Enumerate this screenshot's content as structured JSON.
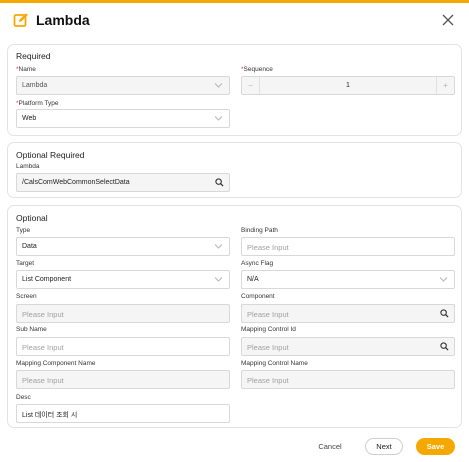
{
  "dialog": {
    "title": "Lambda",
    "accent_color": "#f5a800"
  },
  "required": {
    "title": "Required",
    "name": {
      "label": "Name",
      "required_mark": "*",
      "value": "Lambda"
    },
    "sequence": {
      "label": "Sequence",
      "required_mark": "*",
      "value": "1",
      "minus": "−",
      "plus": "+"
    },
    "platform_type": {
      "label": "Platform Type",
      "required_mark": "*",
      "value": "Web"
    }
  },
  "optional_required": {
    "title": "Optional Required",
    "lambda": {
      "label": "Lambda",
      "value": "/CalsComWebCommonSelectData"
    }
  },
  "optional": {
    "title": "Optional",
    "type": {
      "label": "Type",
      "value": "Data"
    },
    "binding_path": {
      "label": "Binding Path",
      "placeholder": "Please Input"
    },
    "target": {
      "label": "Target",
      "value": "List Component"
    },
    "async_flag": {
      "label": "Async Flag",
      "value": "N/A"
    },
    "screen": {
      "label": "Screen",
      "placeholder": "Please Input"
    },
    "component": {
      "label": "Component",
      "placeholder": "Please Input"
    },
    "sub_name": {
      "label": "Sub Name",
      "placeholder": "Please Input"
    },
    "mapping_control_id": {
      "label": "Mapping Control Id",
      "placeholder": "Please Input"
    },
    "mapping_component_name": {
      "label": "Mapping Component Name",
      "placeholder": "Please Input"
    },
    "mapping_control_name": {
      "label": "Mapping Control Name",
      "placeholder": "Please Input"
    },
    "desc": {
      "label": "Desc",
      "value": "List 데이터 조회 시"
    }
  },
  "footer": {
    "cancel": "Cancel",
    "next": "Next",
    "save": "Save"
  },
  "icons": {
    "header": "edit-icon",
    "close": "close-icon",
    "dropdown": "chevron-down-icon",
    "search": "search-icon"
  }
}
